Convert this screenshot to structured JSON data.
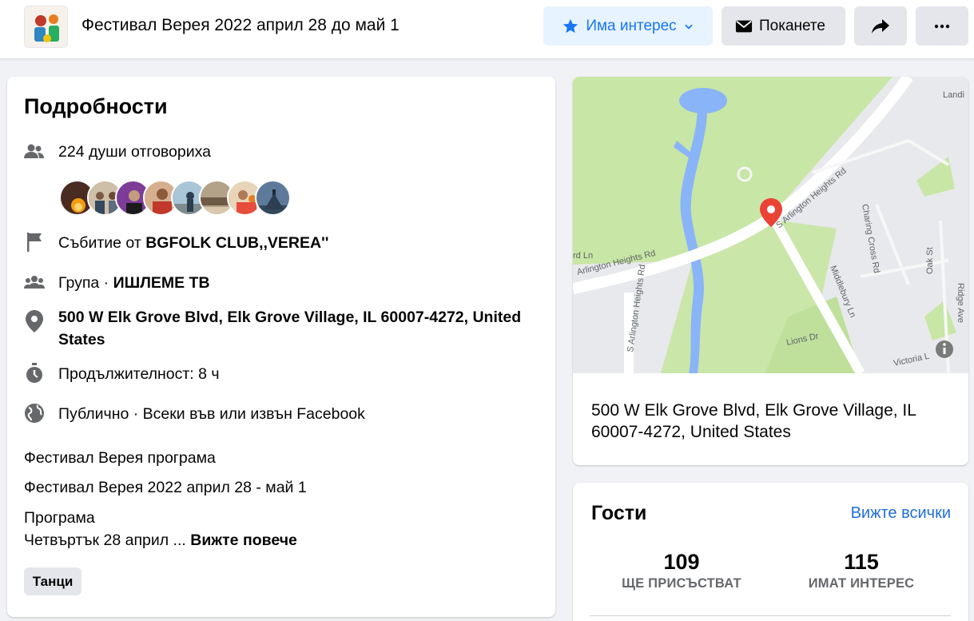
{
  "header": {
    "event_title": "Фестивал Верея 2022 април 28 до май 1",
    "interest_button": "Има интерес",
    "invite_button": "Поканете"
  },
  "details": {
    "title": "Подробности",
    "responded": "224 души отговориха",
    "event_by_prefix": "Събитие от ",
    "event_by_name": "BGFOLK CLUB,,VEREA''",
    "group_prefix": "Група · ",
    "group_name": "ИШЛЕМЕ ТВ",
    "address": "500 W Elk Grove Blvd, Elk Grove Village, IL 60007-4272, United States",
    "duration": "Продължителност: 8 ч",
    "privacy": "Публично · Всеки във или извън Facebook",
    "description_line1": "Фестивал Верея програма",
    "description_line2": "Фестивал Верея 2022 април 28 - май 1",
    "description_line3": "Програма",
    "description_line4": "Четвъртък 28 април ...",
    "see_more": "Вижте повече",
    "tag": "Танци"
  },
  "map": {
    "address": "500 W Elk Grove Blvd, Elk Grove Village, IL 60007-4272, United States",
    "labels": {
      "arlington_heights_rd_top": "S Arlington Heights Rd",
      "arlington_heights_rd_left": "Arlington Heights Rd",
      "arlington_heights_rd_vertical": "S Arlington Heights Rd",
      "charing_cross": "Charing Cross Rd",
      "middlebury": "Middlebury Ln",
      "oak": "Oak St",
      "ridge": "Ridge Ave",
      "lions": "Lions Dr",
      "victoria": "Victoria L",
      "landing": "Landi",
      "rd_ln": "rd Ln"
    }
  },
  "guests": {
    "title": "Гости",
    "see_all": "Вижте всички",
    "going_count": "109",
    "going_label": "ЩЕ ПРИСЪСТВАТ",
    "interested_count": "115",
    "interested_label": "ИМАТ ИНТЕРЕС"
  },
  "colors": {
    "accent_blue": "#1877f2",
    "map_green": "#c8e6a5",
    "map_water": "#8ab4f8",
    "pin_red": "#ea4335"
  }
}
